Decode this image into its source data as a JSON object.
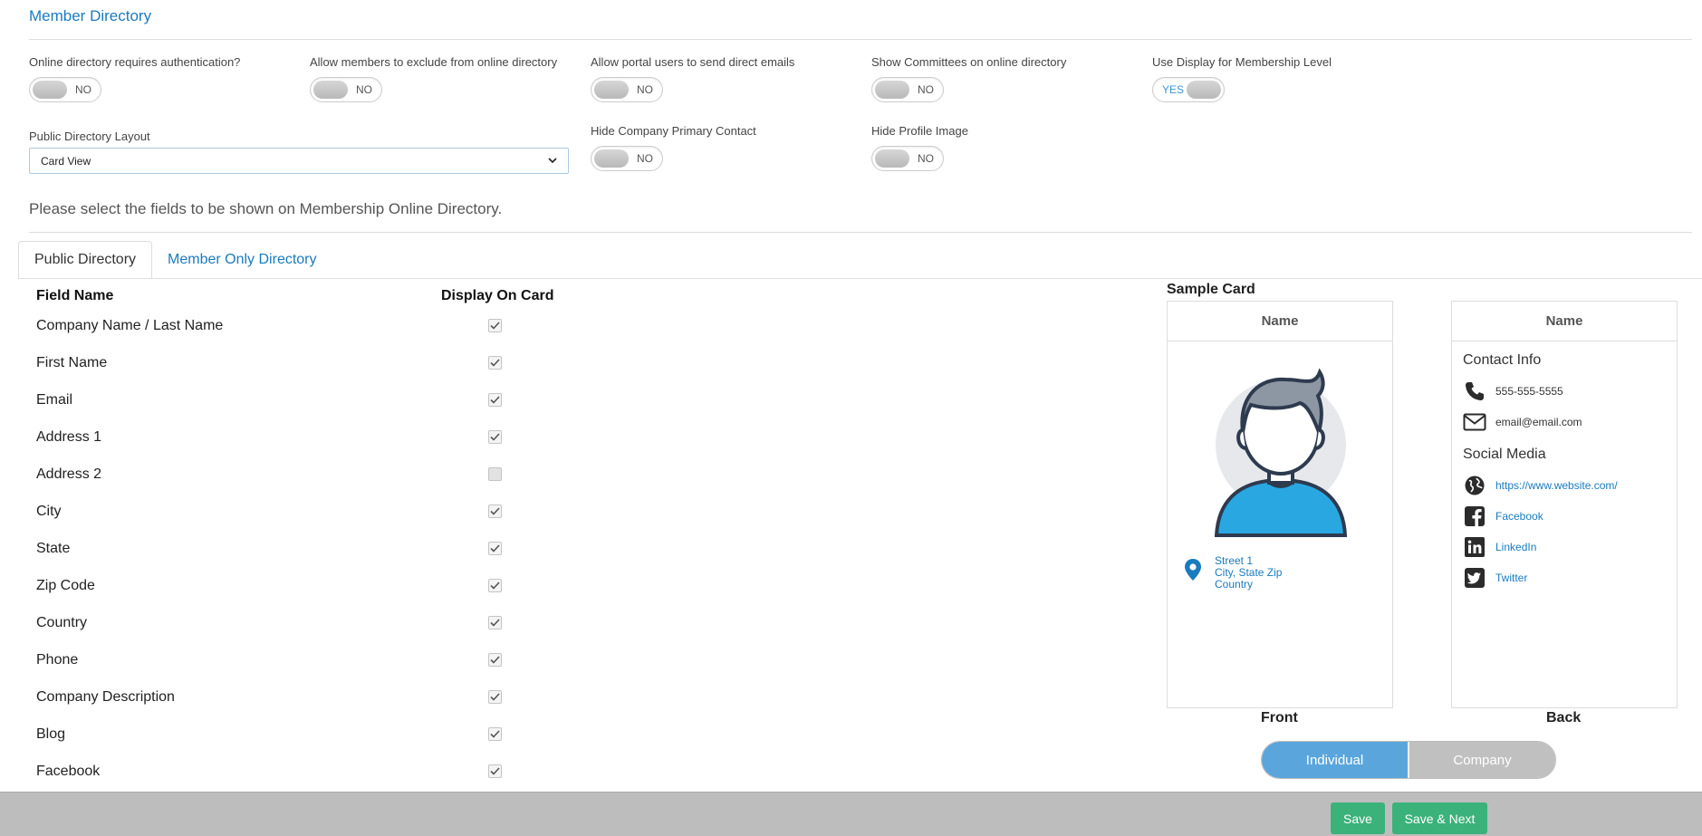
{
  "section_title": "Member Directory",
  "settings": [
    {
      "label": "Online directory requires authentication?",
      "state": "NO"
    },
    {
      "label": "Allow members to exclude from online directory",
      "state": "NO"
    },
    {
      "label": "Allow portal users to send direct emails",
      "state": "NO"
    },
    {
      "label": "Show Committees on online directory",
      "state": "NO"
    },
    {
      "label": "Use Display for Membership Level",
      "state": "YES"
    },
    {
      "label": "Public Directory Layout",
      "value": "Card View"
    },
    {
      "label": "Hide Company Primary Contact",
      "state": "NO"
    },
    {
      "label": "Hide Profile Image",
      "state": "NO"
    }
  ],
  "instruction": "Please select the fields to be shown on Membership Online Directory.",
  "tabs": [
    {
      "label": "Public Directory",
      "active": true
    },
    {
      "label": "Member Only Directory",
      "active": false
    }
  ],
  "table": {
    "col_field": "Field Name",
    "col_display": "Display On Card",
    "rows": [
      {
        "name": "Company Name / Last Name",
        "checked": true
      },
      {
        "name": "First Name",
        "checked": true
      },
      {
        "name": "Email",
        "checked": true
      },
      {
        "name": "Address 1",
        "checked": true
      },
      {
        "name": "Address 2",
        "checked": false
      },
      {
        "name": "City",
        "checked": true
      },
      {
        "name": "State",
        "checked": true
      },
      {
        "name": "Zip Code",
        "checked": true
      },
      {
        "name": "Country",
        "checked": true
      },
      {
        "name": "Phone",
        "checked": true
      },
      {
        "name": "Company Description",
        "checked": true
      },
      {
        "name": "Blog",
        "checked": true
      },
      {
        "name": "Facebook",
        "checked": true
      }
    ]
  },
  "sample_card": {
    "title": "Sample Card",
    "front_name": "Name",
    "back_name": "Name",
    "address": [
      "Street 1",
      "City, State Zip",
      "Country"
    ],
    "contact_info_title": "Contact Info",
    "phone": "555-555-5555",
    "email": "email@email.com",
    "social_title": "Social Media",
    "website": "https://www.website.com/",
    "facebook": "Facebook",
    "linkedin": "LinkedIn",
    "twitter": "Twitter",
    "front_label": "Front",
    "back_label": "Back",
    "segment_individual": "Individual",
    "segment_company": "Company"
  },
  "footer": {
    "save": "Save",
    "save_next": "Save & Next"
  },
  "colors": {
    "link": "#1a7bbf",
    "save_button": "#3bb27a",
    "segment_active": "#5aa6dc",
    "segment_inactive": "#c0c0c0",
    "footer_bar": "#bdbdbd"
  }
}
